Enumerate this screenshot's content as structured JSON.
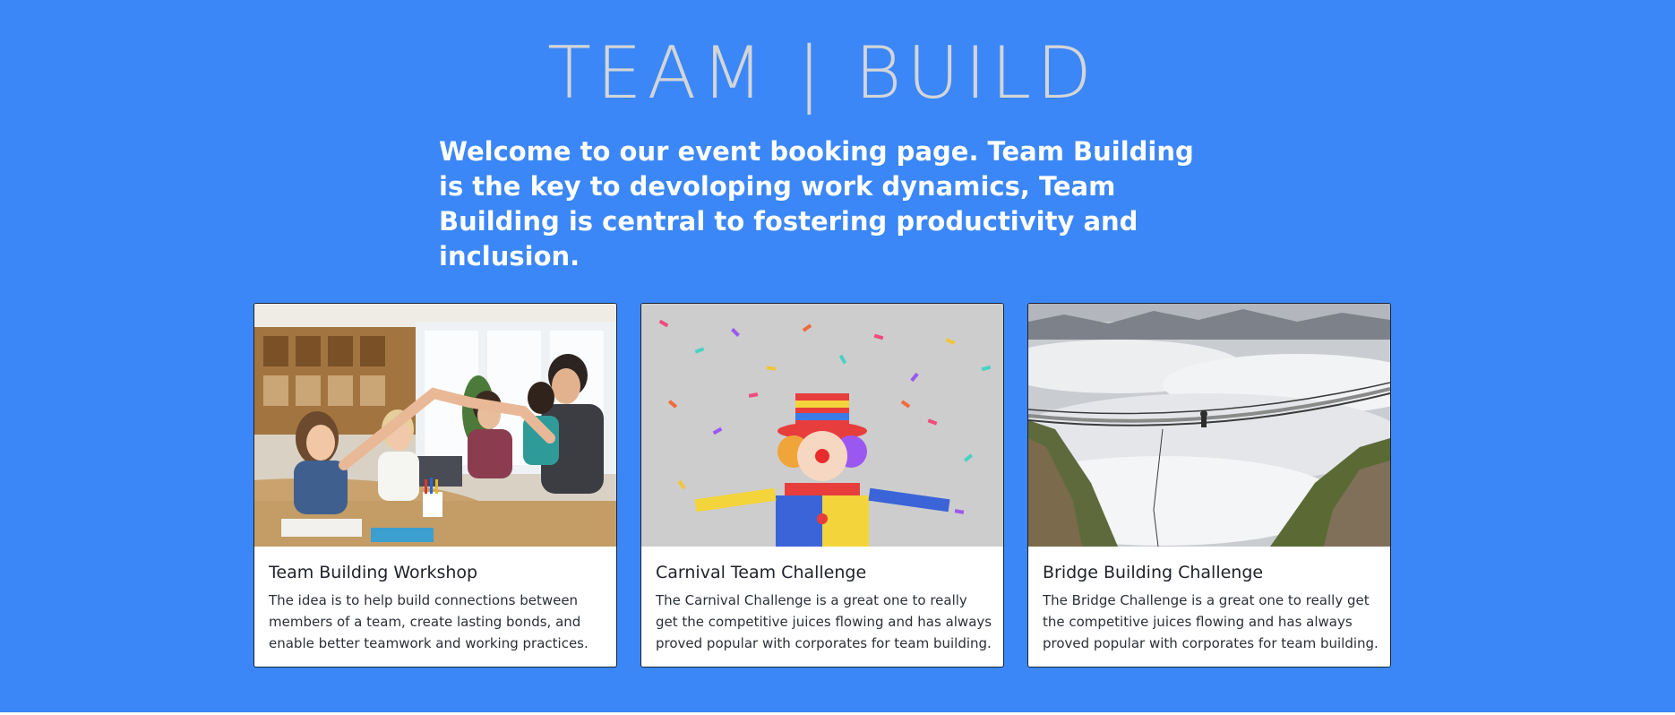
{
  "header": {
    "brand": "TEAM | BUILD",
    "intro": "Welcome to our event booking page. Team Building is the key to devoloping work dynamics, Team Building is central to fostering productivity and inclusion."
  },
  "cards": [
    {
      "title": "Team Building Workshop",
      "text": "The idea is to help build connections between members of a team, create lasting bonds, and enable better teamwork and working practices.",
      "image": "office-team-high-five-photo"
    },
    {
      "title": "Carnival Team Challenge",
      "text": "The Carnival Challenge is a great one to really get the competitive juices flowing and has always proved popular with corporates for team building.",
      "image": "clown-with-confetti-photo"
    },
    {
      "title": "Bridge Building Challenge",
      "text": "The Bridge Challenge is a great one to really get the competitive juices flowing and has always proved popular with corporates for team building.",
      "image": "rope-bridge-above-clouds-photo"
    }
  ],
  "colors": {
    "hero_background": "#3b87f7",
    "brand_text": "#d3d5d8",
    "intro_text": "#ffffff",
    "card_border": "#1c2230"
  }
}
